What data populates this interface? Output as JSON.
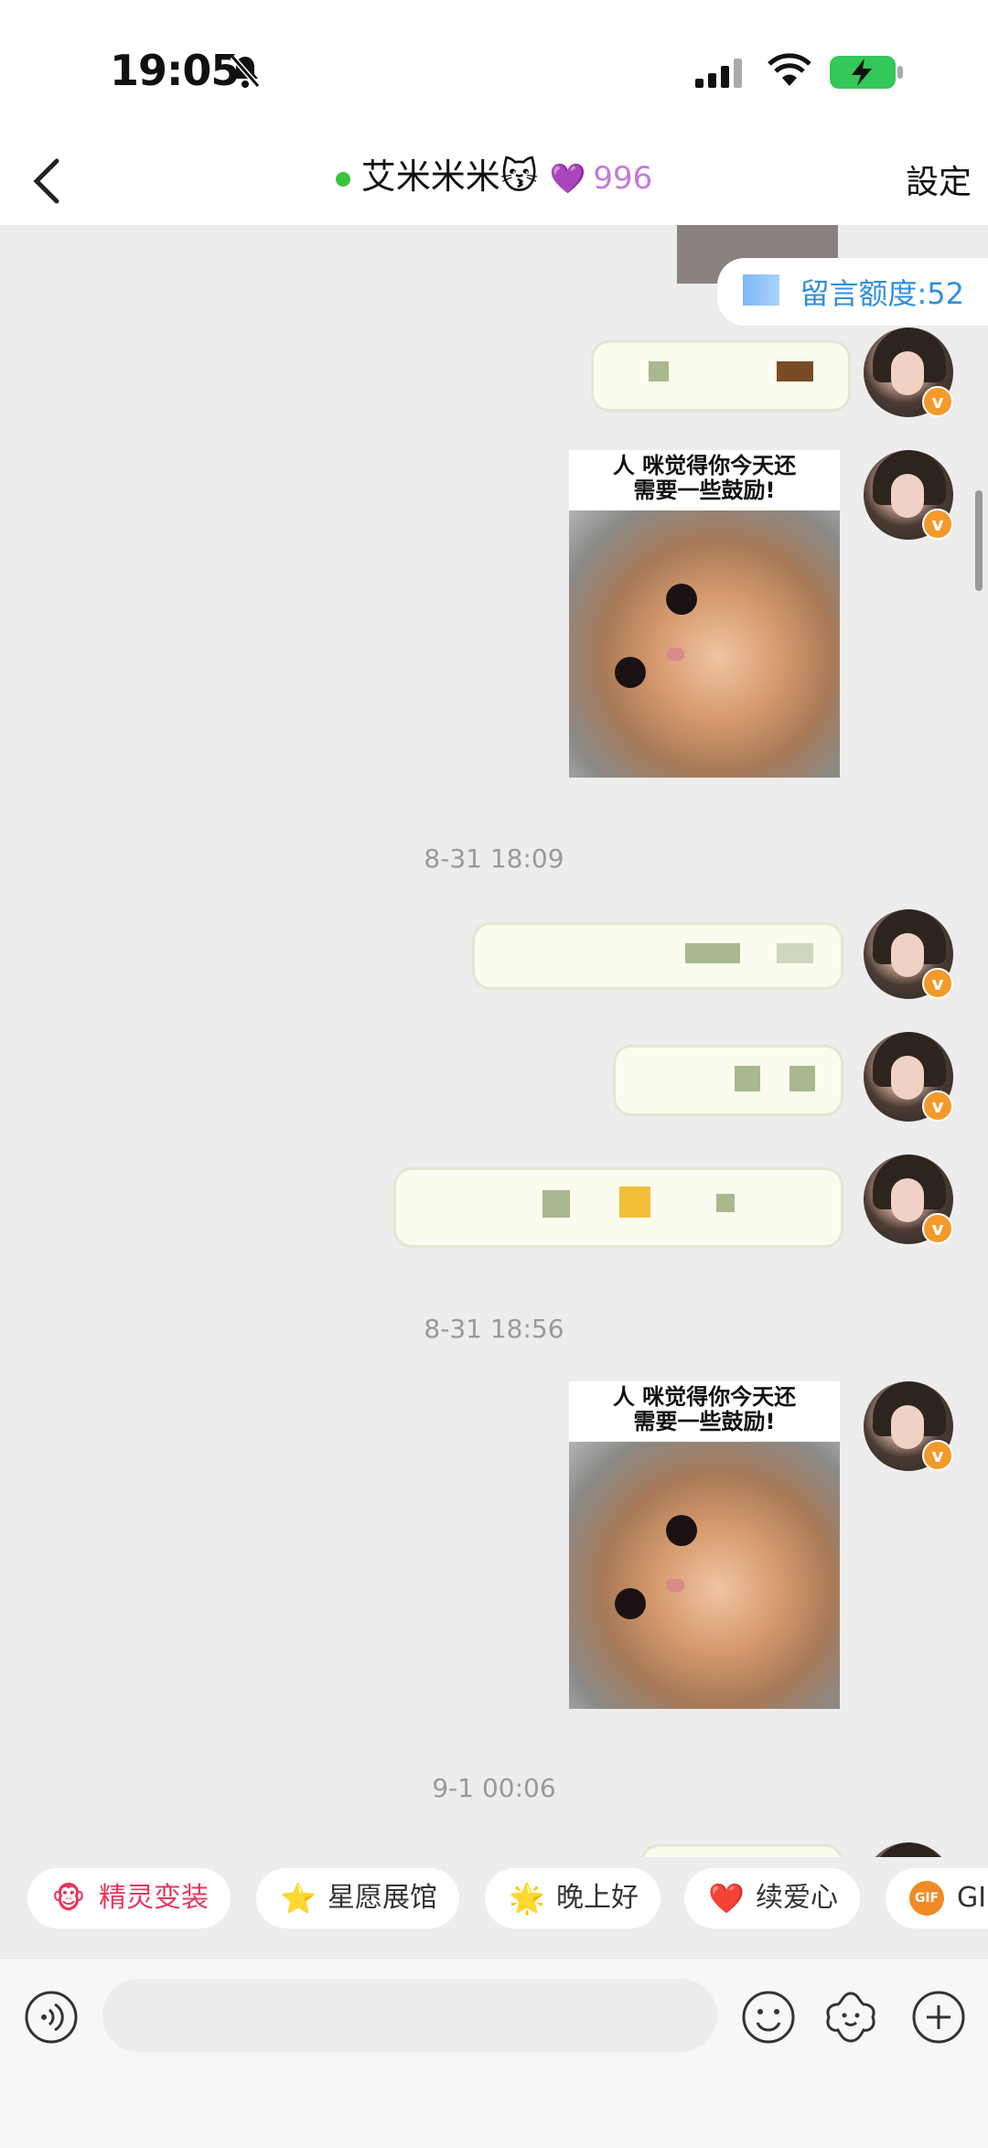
{
  "status_bar": {
    "time": "19:05"
  },
  "header": {
    "title": "艾米米米",
    "title_emoji": "😽",
    "heart_icon": "heart-icon",
    "heart_count": "996",
    "settings_label": "設定"
  },
  "quota": {
    "label": "留言额度:52"
  },
  "messages": [
    {
      "type": "sticker",
      "caption_line1": "人 咪觉得你今天还",
      "caption_line2": "需要一些鼓励!"
    },
    {
      "type": "timestamp",
      "text": "8-31 18:09"
    },
    {
      "type": "timestamp",
      "text": "8-31 18:56"
    },
    {
      "type": "sticker",
      "caption_line1": "人 咪觉得你今天还",
      "caption_line2": "需要一些鼓励!"
    },
    {
      "type": "timestamp",
      "text": "9-1 00:06"
    }
  ],
  "quick_actions": [
    {
      "label": "精灵变装",
      "icon": "🐵"
    },
    {
      "label": "星愿展馆",
      "icon": "⭐"
    },
    {
      "label": "晚上好",
      "icon": "🌟"
    },
    {
      "label": "续爱心",
      "icon": "❤️"
    },
    {
      "label": "GI",
      "icon": "GIF"
    }
  ],
  "colors": {
    "accent_blue": "#2f8fe0",
    "badge_orange": "#f39a2a",
    "online_green": "#3cc43c"
  }
}
